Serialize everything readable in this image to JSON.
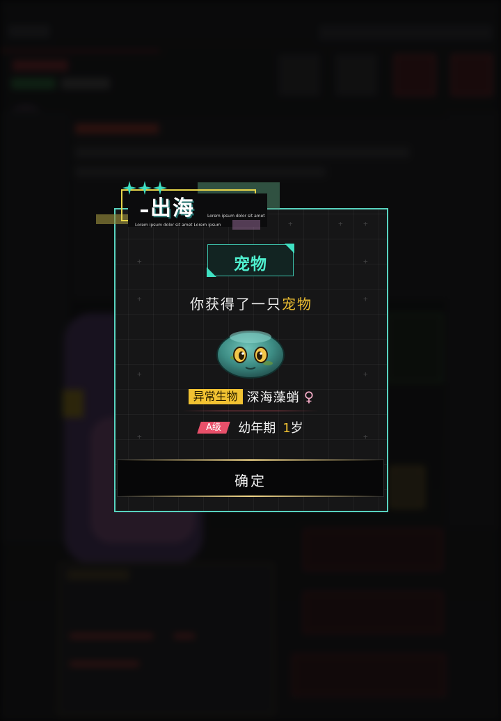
{
  "modal": {
    "title": "出海",
    "lorem_top": "Lorem ipsum dolor sit amet",
    "lorem_bottom": "Lorem ipsum dolor sit amet Lorem ipsum",
    "category": "宠物",
    "message_prefix": "你获得了一只",
    "message_highlight": "宠物",
    "species_tag": "异常生物",
    "species_name": "深海藻蛸",
    "sex_symbol": "♀",
    "grade": "A级",
    "life_stage": "幼年期",
    "age_number": "1",
    "age_unit": "岁",
    "confirm_label": "确定",
    "creature_icon": "slime-creature-icon"
  },
  "colors": {
    "accent_cyan": "#58d3c0",
    "highlight_gold": "#f1c232",
    "grade_pink": "#e8506a",
    "female_pink": "#f0a9c4"
  }
}
